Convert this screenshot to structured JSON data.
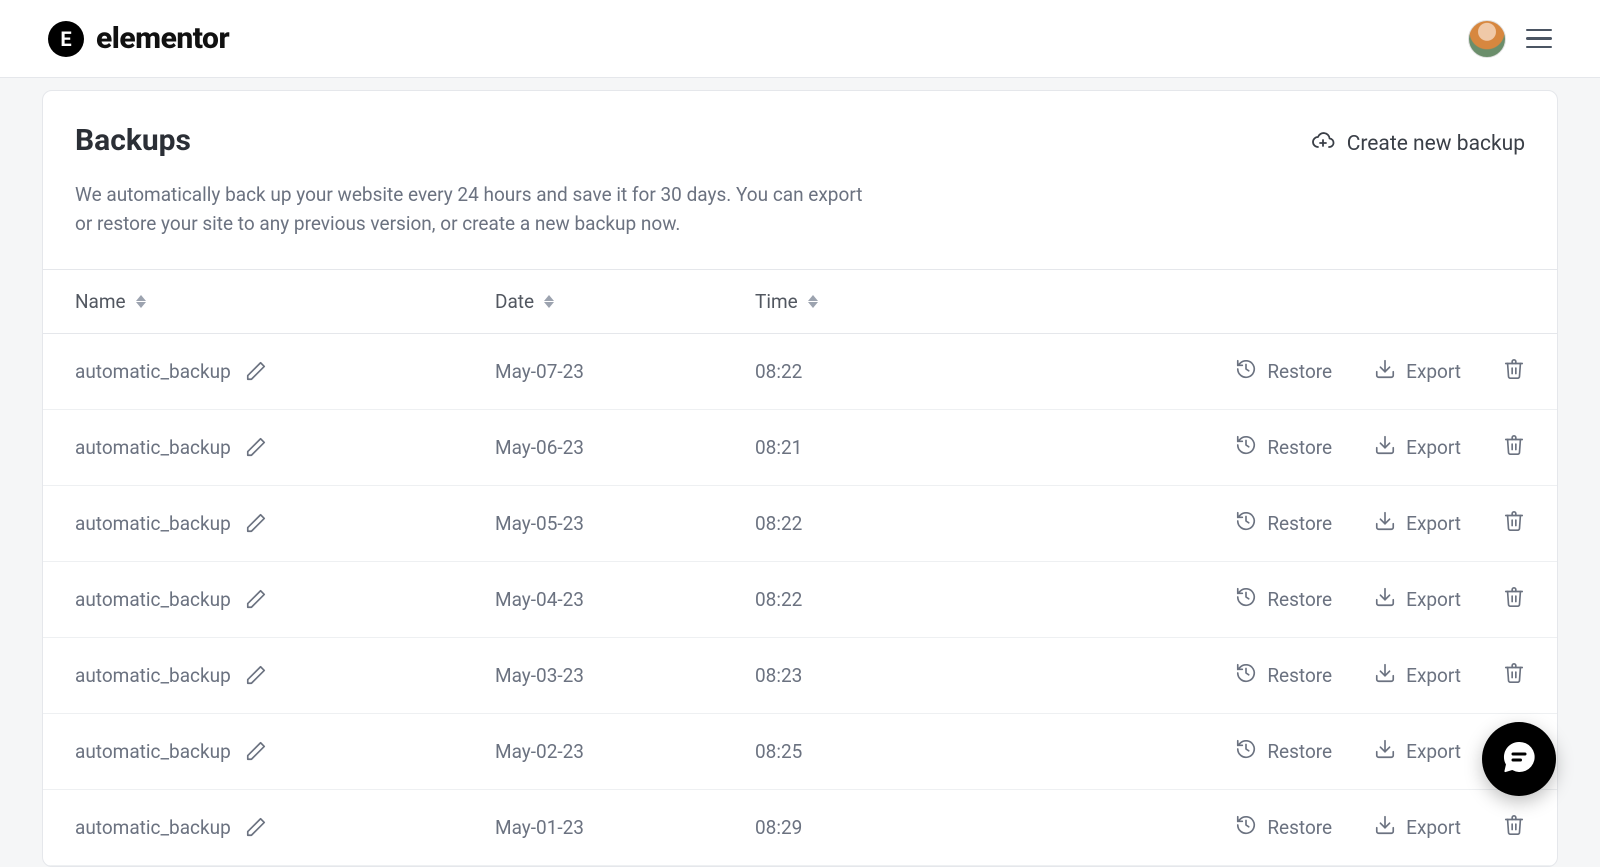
{
  "header": {
    "logo_text": "elementor",
    "logo_badge": "E"
  },
  "page": {
    "title": "Backups",
    "description": "We automatically back up your website every 24 hours and save it for 30 days. You can export or restore your site to any previous version, or create a new backup now.",
    "create_label": "Create new backup"
  },
  "table": {
    "headers": {
      "name": "Name",
      "date": "Date",
      "time": "Time"
    },
    "actions": {
      "restore": "Restore",
      "export": "Export"
    },
    "rows": [
      {
        "name": "automatic_backup",
        "date": "May-07-23",
        "time": "08:22"
      },
      {
        "name": "automatic_backup",
        "date": "May-06-23",
        "time": "08:21"
      },
      {
        "name": "automatic_backup",
        "date": "May-05-23",
        "time": "08:22"
      },
      {
        "name": "automatic_backup",
        "date": "May-04-23",
        "time": "08:22"
      },
      {
        "name": "automatic_backup",
        "date": "May-03-23",
        "time": "08:23"
      },
      {
        "name": "automatic_backup",
        "date": "May-02-23",
        "time": "08:25"
      },
      {
        "name": "automatic_backup",
        "date": "May-01-23",
        "time": "08:29"
      }
    ]
  }
}
